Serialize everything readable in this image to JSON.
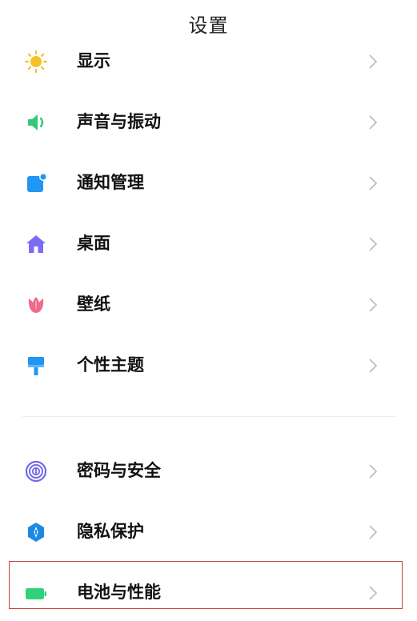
{
  "header": {
    "title": "设置"
  },
  "menu_group_1": [
    {
      "label": "显示",
      "icon": "sun-icon",
      "color": "#F7C02B"
    },
    {
      "label": "声音与振动",
      "icon": "speaker-icon",
      "color": "#34C77B"
    },
    {
      "label": "通知管理",
      "icon": "notification-icon",
      "color": "#2196F3"
    },
    {
      "label": "桌面",
      "icon": "home-icon",
      "color": "#7B6CF6"
    },
    {
      "label": "壁纸",
      "icon": "tulip-icon",
      "color": "#F06A8A"
    },
    {
      "label": "个性主题",
      "icon": "paintbrush-icon",
      "color": "#2196F3"
    }
  ],
  "menu_group_2": [
    {
      "label": "密码与安全",
      "icon": "fingerprint-icon",
      "color": "#6F6AE8"
    },
    {
      "label": "隐私保护",
      "icon": "privacy-shield-icon",
      "color": "#1E88E5"
    },
    {
      "label": "电池与性能",
      "icon": "battery-icon",
      "color": "#2FD27A"
    }
  ],
  "highlight_color": "#C44536",
  "chevron_color": "#BBBBBB"
}
